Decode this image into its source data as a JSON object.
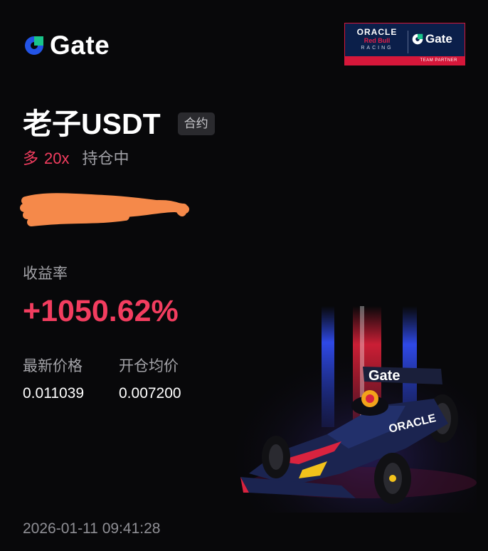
{
  "brand": {
    "name": "Gate",
    "color": "#2354e6"
  },
  "partner": {
    "line1": "ORACLE",
    "line2": "Red Bull",
    "line3": "RACING",
    "brand": "Gate",
    "tagline": "TEAM PARTNER"
  },
  "position": {
    "pair": "老子USDT",
    "market_tag": "合约",
    "side": "多",
    "leverage": "20x",
    "status": "持仓中"
  },
  "roi": {
    "label": "收益率",
    "value": "+1050.62%"
  },
  "prices": {
    "latest_label": "最新价格",
    "latest_value": "0.011039",
    "entry_label": "开仓均价",
    "entry_value": "0.007200"
  },
  "timestamp": "2026-01-11 09:41:28",
  "colors": {
    "background": "#08080a",
    "profit": "#f23d5f",
    "muted": "#a3a3a8",
    "redaction": "#f5894a"
  },
  "car_livery": {
    "text": "Gate",
    "sponsor": "ORACLE"
  }
}
